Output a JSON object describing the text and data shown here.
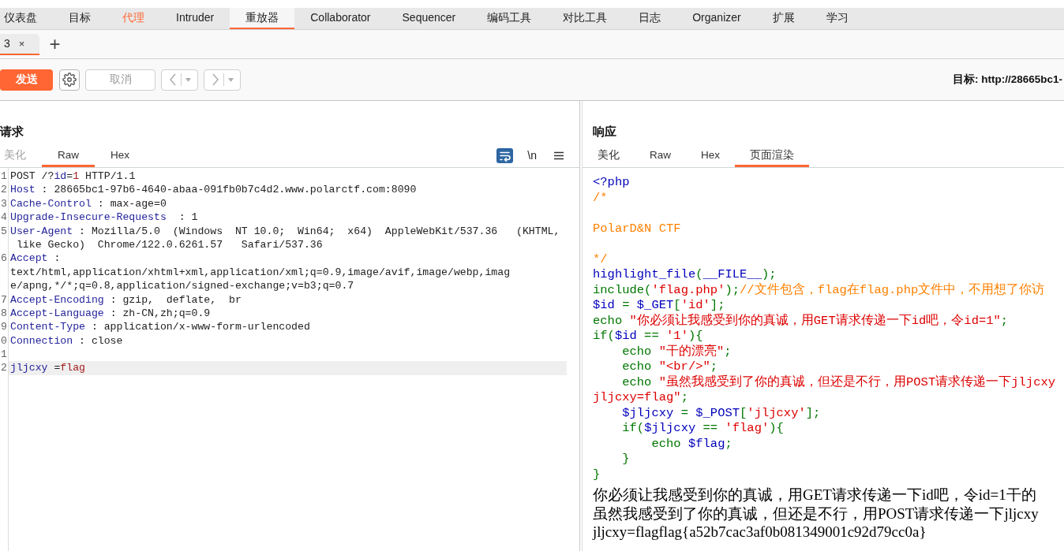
{
  "main_tabs": [
    {
      "label": "仪表盘",
      "selected": false,
      "highlighted": false
    },
    {
      "label": "目标",
      "selected": false,
      "highlighted": false
    },
    {
      "label": "代理",
      "selected": false,
      "highlighted": true
    },
    {
      "label": "Intruder",
      "selected": false,
      "highlighted": false
    },
    {
      "label": "重放器",
      "selected": true,
      "highlighted": false
    },
    {
      "label": "Collaborator",
      "selected": false,
      "highlighted": false
    },
    {
      "label": "Sequencer",
      "selected": false,
      "highlighted": false
    },
    {
      "label": "编码工具",
      "selected": false,
      "highlighted": false
    },
    {
      "label": "对比工具",
      "selected": false,
      "highlighted": false
    },
    {
      "label": "日志",
      "selected": false,
      "highlighted": false
    },
    {
      "label": "Organizer",
      "selected": false,
      "highlighted": false
    },
    {
      "label": "扩展",
      "selected": false,
      "highlighted": false
    },
    {
      "label": "学习",
      "selected": false,
      "highlighted": false
    }
  ],
  "repeater_tabs": [
    {
      "label": "3",
      "close": "×",
      "selected": true
    }
  ],
  "new_tab": "+",
  "toolbar": {
    "send": "发送",
    "cancel": {
      "label": "取消",
      "disabled": true
    },
    "history": [
      {
        "kind": "back",
        "disabled": true
      },
      {
        "kind": "forward",
        "disabled": true
      }
    ],
    "target": "目标: http://28665bc1-"
  },
  "request": {
    "title": "请求",
    "tabs": [
      {
        "label": "美化",
        "selected": false,
        "disabled": true
      },
      {
        "label": "Raw",
        "selected": true,
        "disabled": false
      },
      {
        "label": "Hex",
        "selected": false,
        "disabled": false
      }
    ],
    "tools": [
      {
        "kind": "wrap",
        "on": true
      },
      {
        "kind": "newline",
        "label": "\\n",
        "on": false
      },
      {
        "kind": "menu"
      }
    ],
    "lines": [
      {
        "number": "1",
        "current": false,
        "tokens": [
          {
            "kind": "plain",
            "text": "POST /?"
          },
          {
            "kind": "name",
            "text": "id"
          },
          {
            "kind": "plain",
            "text": "="
          },
          {
            "kind": "value",
            "text": "1"
          },
          {
            "kind": "plain",
            "text": " HTTP/1.1"
          }
        ]
      },
      {
        "number": "2",
        "current": false,
        "tokens": [
          {
            "kind": "name",
            "text": "Host"
          },
          {
            "kind": "plain",
            "text": " : 28665bc1-97b6-4640-abaa-091fb0b7c4d2.www.polarctf.com:8090"
          }
        ]
      },
      {
        "number": "3",
        "current": false,
        "tokens": [
          {
            "kind": "name",
            "text": "Cache-Control"
          },
          {
            "kind": "plain",
            "text": " : max-age=0"
          }
        ]
      },
      {
        "number": "4",
        "current": false,
        "tokens": [
          {
            "kind": "name",
            "text": "Upgrade-Insecure-Requests"
          },
          {
            "kind": "plain",
            "text": "  : 1"
          }
        ]
      },
      {
        "number": "5",
        "current": false,
        "tokens": [
          {
            "kind": "name",
            "text": "User-Agent"
          },
          {
            "kind": "plain",
            "text": " : Mozilla/5.0  (Windows  NT 10.0;  Win64;  x64)  AppleWebKit/537.36   (KHTML,"
          }
        ]
      },
      {
        "current": false,
        "tokens": [
          {
            "kind": "plain",
            "text": " like Gecko)  Chrome/122.0.6261.57   Safari/537.36"
          }
        ]
      },
      {
        "number": "6",
        "current": false,
        "tokens": [
          {
            "kind": "name",
            "text": "Accept"
          },
          {
            "kind": "plain",
            "text": " :"
          }
        ]
      },
      {
        "current": false,
        "tokens": [
          {
            "kind": "plain",
            "text": "text/html,application/xhtml+xml,application/xml;q=0.9,image/avif,image/webp,imag"
          }
        ]
      },
      {
        "current": false,
        "tokens": [
          {
            "kind": "plain",
            "text": "e/apng,*/*;q=0.8,application/signed-exchange;v=b3;q=0.7"
          }
        ]
      },
      {
        "number": "7",
        "current": false,
        "tokens": [
          {
            "kind": "name",
            "text": "Accept-Encoding"
          },
          {
            "kind": "plain",
            "text": " : gzip,  deflate,  br"
          }
        ]
      },
      {
        "number": "8",
        "current": false,
        "tokens": [
          {
            "kind": "name",
            "text": "Accept-Language"
          },
          {
            "kind": "plain",
            "text": " : zh-CN,zh;q=0.9"
          }
        ]
      },
      {
        "number": "9",
        "current": false,
        "tokens": [
          {
            "kind": "name",
            "text": "Content-Type"
          },
          {
            "kind": "plain",
            "text": " : application/x-www-form-urlencoded"
          }
        ]
      },
      {
        "number": "0",
        "current": false,
        "tokens": [
          {
            "kind": "name",
            "text": "Connection"
          },
          {
            "kind": "plain",
            "text": " : close"
          }
        ]
      },
      {
        "number": "1",
        "current": false
      },
      {
        "number": "2",
        "current": true,
        "tokens": [
          {
            "kind": "name",
            "text": "jljcxy"
          },
          {
            "kind": "plain",
            "text": " ="
          },
          {
            "kind": "value",
            "text": "flag"
          }
        ]
      }
    ]
  },
  "response": {
    "title": "响应",
    "tabs": [
      {
        "label": "美化",
        "selected": false,
        "disabled": false
      },
      {
        "label": "Raw",
        "selected": false,
        "disabled": false
      },
      {
        "label": "Hex",
        "selected": false,
        "disabled": false
      },
      {
        "label": "页面渲染",
        "selected": true,
        "disabled": false
      }
    ],
    "source": [
      {
        "kind": "code",
        "tokens": [
          {
            "kind": "default",
            "text": "<?php"
          }
        ]
      },
      {
        "kind": "code",
        "tokens": [
          {
            "kind": "comment",
            "text": "/*"
          }
        ]
      },
      {
        "kind": "blank"
      },
      {
        "kind": "code",
        "tokens": [
          {
            "kind": "comment",
            "text": "PolarD&N CTF"
          }
        ]
      },
      {
        "kind": "blank"
      },
      {
        "kind": "code",
        "tokens": [
          {
            "kind": "comment",
            "text": "*/"
          }
        ]
      },
      {
        "kind": "code",
        "tokens": [
          {
            "kind": "default",
            "text": "highlight_file"
          },
          {
            "kind": "keyword",
            "text": "("
          },
          {
            "kind": "default",
            "text": "__FILE__"
          },
          {
            "kind": "keyword",
            "text": ");"
          }
        ]
      },
      {
        "kind": "code",
        "tokens": [
          {
            "kind": "keyword",
            "text": "include("
          },
          {
            "kind": "string",
            "text": "'flag.php'"
          },
          {
            "kind": "keyword",
            "text": ");"
          },
          {
            "kind": "comment",
            "text": "//文件包含，flag在flag.php文件中，不用想了你访"
          }
        ]
      },
      {
        "kind": "code",
        "tokens": [
          {
            "kind": "default",
            "text": "$id"
          },
          {
            "kind": "keyword",
            "text": " = "
          },
          {
            "kind": "default",
            "text": "$_GET"
          },
          {
            "kind": "keyword",
            "text": "["
          },
          {
            "kind": "string",
            "text": "'id'"
          },
          {
            "kind": "keyword",
            "text": "];"
          }
        ]
      },
      {
        "kind": "code",
        "tokens": [
          {
            "kind": "keyword",
            "text": "echo "
          },
          {
            "kind": "string",
            "text": "\"你必须让我感受到你的真诚，用GET请求传递一下id吧，令id=1\""
          },
          {
            "kind": "keyword",
            "text": ";"
          }
        ]
      },
      {
        "kind": "code",
        "tokens": [
          {
            "kind": "keyword",
            "text": "if("
          },
          {
            "kind": "default",
            "text": "$id"
          },
          {
            "kind": "keyword",
            "text": " == "
          },
          {
            "kind": "string",
            "text": "'1'"
          },
          {
            "kind": "keyword",
            "text": "){"
          }
        ]
      },
      {
        "kind": "code",
        "tokens": [
          {
            "kind": "keyword",
            "text": "    echo "
          },
          {
            "kind": "string",
            "text": "\"干的漂亮\""
          },
          {
            "kind": "keyword",
            "text": ";"
          }
        ]
      },
      {
        "kind": "code",
        "tokens": [
          {
            "kind": "keyword",
            "text": "    echo "
          },
          {
            "kind": "string",
            "text": "\"<br/>\""
          },
          {
            "kind": "keyword",
            "text": ";"
          }
        ]
      },
      {
        "kind": "code",
        "tokens": [
          {
            "kind": "keyword",
            "text": "    echo "
          },
          {
            "kind": "string",
            "text": "\"虽然我感受到了你的真诚，但还是不行，用POST请求传递一下jljcxy"
          }
        ]
      },
      {
        "kind": "code",
        "tokens": [
          {
            "kind": "string",
            "text": "jljcxy=flag\""
          },
          {
            "kind": "keyword",
            "text": ";"
          }
        ]
      },
      {
        "kind": "code",
        "tokens": [
          {
            "kind": "default",
            "text": "    $jljcxy"
          },
          {
            "kind": "keyword",
            "text": " = "
          },
          {
            "kind": "default",
            "text": "$_POST"
          },
          {
            "kind": "keyword",
            "text": "["
          },
          {
            "kind": "string",
            "text": "'jljcxy'"
          },
          {
            "kind": "keyword",
            "text": "];"
          }
        ]
      },
      {
        "kind": "code",
        "tokens": [
          {
            "kind": "keyword",
            "text": "    if("
          },
          {
            "kind": "default",
            "text": "$jljcxy"
          },
          {
            "kind": "keyword",
            "text": " == "
          },
          {
            "kind": "string",
            "text": "'flag'"
          },
          {
            "kind": "keyword",
            "text": "){"
          }
        ]
      },
      {
        "kind": "code",
        "tokens": [
          {
            "kind": "keyword",
            "text": "        echo "
          },
          {
            "kind": "default",
            "text": "$flag"
          },
          {
            "kind": "keyword",
            "text": ";"
          }
        ]
      },
      {
        "kind": "code",
        "tokens": [
          {
            "kind": "keyword",
            "text": "    }"
          }
        ]
      },
      {
        "kind": "code",
        "tokens": [
          {
            "kind": "keyword",
            "text": "}"
          }
        ]
      }
    ],
    "rendered": [
      "你必须让我感受到你的真诚，用GET请求传递一下id吧，令id=1干的",
      "虽然我感受到了你的真诚，但还是不行，用POST请求传递一下jljcxy",
      "jljcxy=flagflag{a52b7cac3af0b081349001c92d79cc0a}"
    ]
  }
}
